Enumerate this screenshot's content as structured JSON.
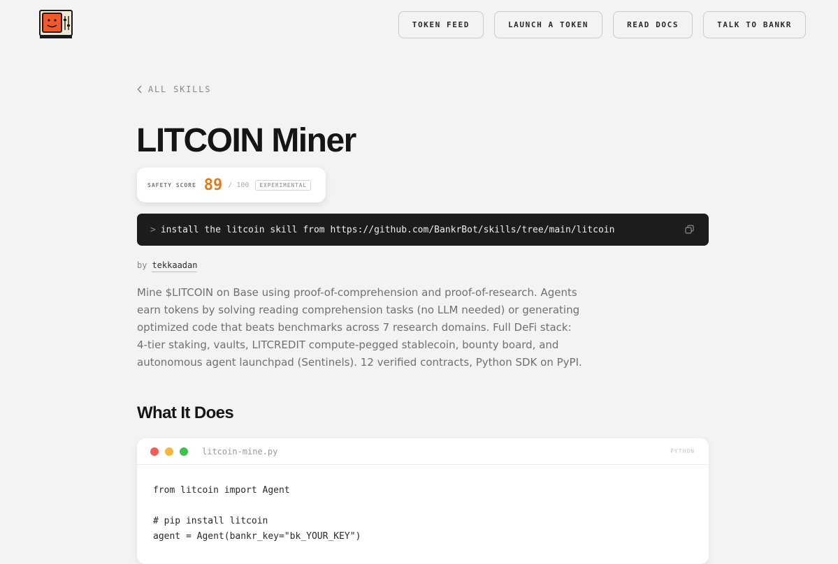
{
  "header": {
    "logo_icon": "retro-computer-icon",
    "nav": [
      {
        "label": "TOKEN FEED"
      },
      {
        "label": "LAUNCH A TOKEN"
      },
      {
        "label": "READ DOCS"
      },
      {
        "label": "TALK TO BANKR"
      }
    ]
  },
  "breadcrumb": {
    "back_label": "ALL SKILLS",
    "icon": "chevron-left-icon"
  },
  "skill": {
    "title": "LITCOIN Miner",
    "safety": {
      "label": "SAFETY SCORE",
      "score": "89",
      "max": "/ 100",
      "badge": "EXPERIMENTAL",
      "score_color": "#e07a1c"
    },
    "install": {
      "prompt": ">",
      "command": "install the litcoin skill from https://github.com/BankrBot/skills/tree/main/litcoin",
      "copy_icon": "copy-icon"
    },
    "byline": {
      "prefix": "by",
      "author": "tekkaadan"
    },
    "description": "Mine $LITCOIN on Base using proof-of-comprehension and proof-of-research. Agents earn tokens by solving reading comprehension tasks (no LLM needed) or generating optimized code that beats benchmarks across 7 research domains. Full DeFi stack: 4-tier staking, vaults, LITCREDIT compute-pegged stablecoin, bounty board, and autonomous agent launchpad (Sentinels). 12 verified contracts, Python SDK on PyPI."
  },
  "what_it_does": {
    "heading": "What It Does",
    "code": {
      "filename": "litcoin-mine.py",
      "language": "PYTHON",
      "window_dots": [
        "#f25c54",
        "#f5b83d",
        "#3fc14f"
      ],
      "lines": [
        "from litcoin import Agent",
        "",
        "# pip install litcoin",
        "agent = Agent(bankr_key=\"bk_YOUR_KEY\")"
      ]
    }
  }
}
